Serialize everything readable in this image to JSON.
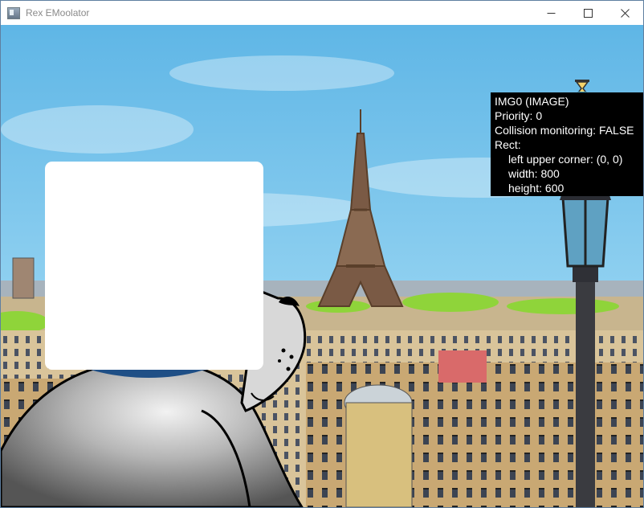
{
  "window": {
    "title": "Rex EMoolator",
    "controls": {
      "minimize": "minimize-icon",
      "maximize": "maximize-icon",
      "close": "close-icon"
    }
  },
  "scene": {
    "description_icons": [
      "eiffel-tower",
      "street-lamp",
      "cow-character",
      "hourglass-cursor"
    ],
    "colors": {
      "sky": "#7cc6ea",
      "info_bg": "#000000",
      "info_text": "#ffffff"
    }
  },
  "info_panel": {
    "title": "IMG0 (IMAGE)",
    "priority": "Priority: 0",
    "collision": "Collision monitoring: FALSE",
    "rect_label": "Rect:",
    "corner": "left upper corner: (0, 0)",
    "width": "width: 800",
    "height": "height: 600"
  }
}
